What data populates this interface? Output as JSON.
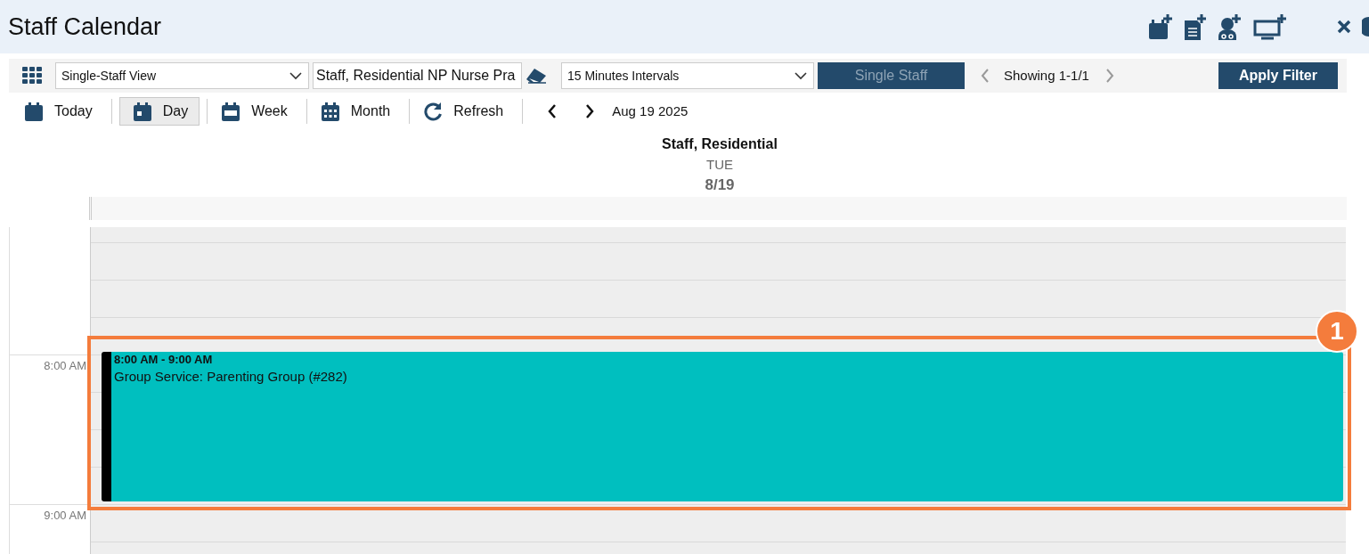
{
  "window": {
    "title": "Staff Calendar"
  },
  "filter_bar": {
    "view_select": "Single-Staff View",
    "staff_field": "Staff, Residential NP Nurse Pra",
    "interval_select": "15 Minutes Intervals",
    "mode_button": {
      "label": "Single Staff",
      "disabled": true
    },
    "showing": "Showing 1-1/1",
    "apply_button": "Apply Filter"
  },
  "view_buttons": [
    {
      "label": "Today",
      "selected": false
    },
    {
      "label": "Day",
      "selected": true
    },
    {
      "label": "Week",
      "selected": false
    },
    {
      "label": "Month",
      "selected": false
    }
  ],
  "refresh_button": "Refresh",
  "current_date": "Aug 19 2025",
  "column": {
    "staff": "Staff, Residential",
    "weekday": "TUE",
    "date": "8/19"
  },
  "hours": [
    {
      "label": "8:00 AM"
    },
    {
      "label": "9:00 AM"
    }
  ],
  "events": [
    {
      "time": "8:00 AM - 9:00 AM",
      "title": "Group Service: Parenting Group (#282)",
      "color": "#00bfbf"
    }
  ],
  "annotation": {
    "number": "1"
  }
}
